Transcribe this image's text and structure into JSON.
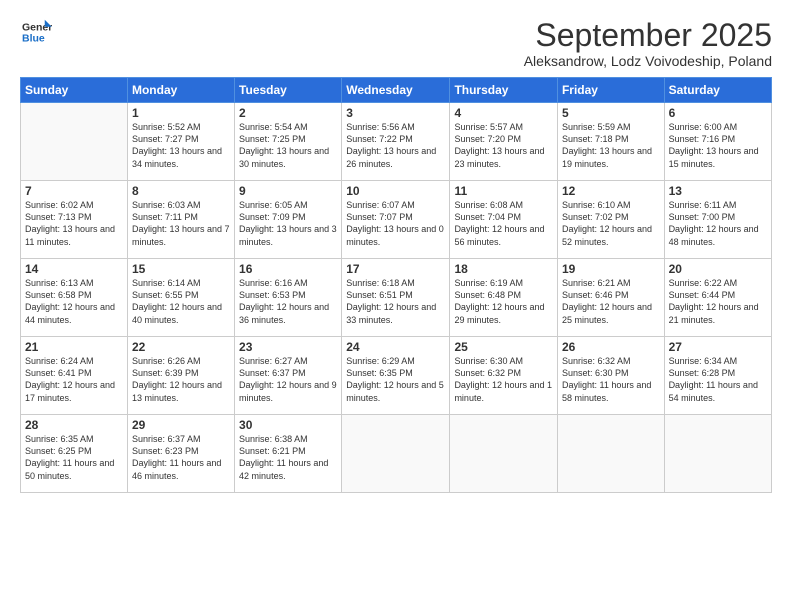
{
  "header": {
    "logo_line1": "General",
    "logo_line2": "Blue",
    "month_title": "September 2025",
    "subtitle": "Aleksandrow, Lodz Voivodeship, Poland"
  },
  "weekdays": [
    "Sunday",
    "Monday",
    "Tuesday",
    "Wednesday",
    "Thursday",
    "Friday",
    "Saturday"
  ],
  "weeks": [
    [
      {
        "day": "",
        "sunrise": "",
        "sunset": "",
        "daylight": ""
      },
      {
        "day": "1",
        "sunrise": "5:52 AM",
        "sunset": "7:27 PM",
        "daylight": "13 hours and 34 minutes."
      },
      {
        "day": "2",
        "sunrise": "5:54 AM",
        "sunset": "7:25 PM",
        "daylight": "13 hours and 30 minutes."
      },
      {
        "day": "3",
        "sunrise": "5:56 AM",
        "sunset": "7:22 PM",
        "daylight": "13 hours and 26 minutes."
      },
      {
        "day": "4",
        "sunrise": "5:57 AM",
        "sunset": "7:20 PM",
        "daylight": "13 hours and 23 minutes."
      },
      {
        "day": "5",
        "sunrise": "5:59 AM",
        "sunset": "7:18 PM",
        "daylight": "13 hours and 19 minutes."
      },
      {
        "day": "6",
        "sunrise": "6:00 AM",
        "sunset": "7:16 PM",
        "daylight": "13 hours and 15 minutes."
      }
    ],
    [
      {
        "day": "7",
        "sunrise": "6:02 AM",
        "sunset": "7:13 PM",
        "daylight": "13 hours and 11 minutes."
      },
      {
        "day": "8",
        "sunrise": "6:03 AM",
        "sunset": "7:11 PM",
        "daylight": "13 hours and 7 minutes."
      },
      {
        "day": "9",
        "sunrise": "6:05 AM",
        "sunset": "7:09 PM",
        "daylight": "13 hours and 3 minutes."
      },
      {
        "day": "10",
        "sunrise": "6:07 AM",
        "sunset": "7:07 PM",
        "daylight": "13 hours and 0 minutes."
      },
      {
        "day": "11",
        "sunrise": "6:08 AM",
        "sunset": "7:04 PM",
        "daylight": "12 hours and 56 minutes."
      },
      {
        "day": "12",
        "sunrise": "6:10 AM",
        "sunset": "7:02 PM",
        "daylight": "12 hours and 52 minutes."
      },
      {
        "day": "13",
        "sunrise": "6:11 AM",
        "sunset": "7:00 PM",
        "daylight": "12 hours and 48 minutes."
      }
    ],
    [
      {
        "day": "14",
        "sunrise": "6:13 AM",
        "sunset": "6:58 PM",
        "daylight": "12 hours and 44 minutes."
      },
      {
        "day": "15",
        "sunrise": "6:14 AM",
        "sunset": "6:55 PM",
        "daylight": "12 hours and 40 minutes."
      },
      {
        "day": "16",
        "sunrise": "6:16 AM",
        "sunset": "6:53 PM",
        "daylight": "12 hours and 36 minutes."
      },
      {
        "day": "17",
        "sunrise": "6:18 AM",
        "sunset": "6:51 PM",
        "daylight": "12 hours and 33 minutes."
      },
      {
        "day": "18",
        "sunrise": "6:19 AM",
        "sunset": "6:48 PM",
        "daylight": "12 hours and 29 minutes."
      },
      {
        "day": "19",
        "sunrise": "6:21 AM",
        "sunset": "6:46 PM",
        "daylight": "12 hours and 25 minutes."
      },
      {
        "day": "20",
        "sunrise": "6:22 AM",
        "sunset": "6:44 PM",
        "daylight": "12 hours and 21 minutes."
      }
    ],
    [
      {
        "day": "21",
        "sunrise": "6:24 AM",
        "sunset": "6:41 PM",
        "daylight": "12 hours and 17 minutes."
      },
      {
        "day": "22",
        "sunrise": "6:26 AM",
        "sunset": "6:39 PM",
        "daylight": "12 hours and 13 minutes."
      },
      {
        "day": "23",
        "sunrise": "6:27 AM",
        "sunset": "6:37 PM",
        "daylight": "12 hours and 9 minutes."
      },
      {
        "day": "24",
        "sunrise": "6:29 AM",
        "sunset": "6:35 PM",
        "daylight": "12 hours and 5 minutes."
      },
      {
        "day": "25",
        "sunrise": "6:30 AM",
        "sunset": "6:32 PM",
        "daylight": "12 hours and 1 minute."
      },
      {
        "day": "26",
        "sunrise": "6:32 AM",
        "sunset": "6:30 PM",
        "daylight": "11 hours and 58 minutes."
      },
      {
        "day": "27",
        "sunrise": "6:34 AM",
        "sunset": "6:28 PM",
        "daylight": "11 hours and 54 minutes."
      }
    ],
    [
      {
        "day": "28",
        "sunrise": "6:35 AM",
        "sunset": "6:25 PM",
        "daylight": "11 hours and 50 minutes."
      },
      {
        "day": "29",
        "sunrise": "6:37 AM",
        "sunset": "6:23 PM",
        "daylight": "11 hours and 46 minutes."
      },
      {
        "day": "30",
        "sunrise": "6:38 AM",
        "sunset": "6:21 PM",
        "daylight": "11 hours and 42 minutes."
      },
      {
        "day": "",
        "sunrise": "",
        "sunset": "",
        "daylight": ""
      },
      {
        "day": "",
        "sunrise": "",
        "sunset": "",
        "daylight": ""
      },
      {
        "day": "",
        "sunrise": "",
        "sunset": "",
        "daylight": ""
      },
      {
        "day": "",
        "sunrise": "",
        "sunset": "",
        "daylight": ""
      }
    ]
  ]
}
